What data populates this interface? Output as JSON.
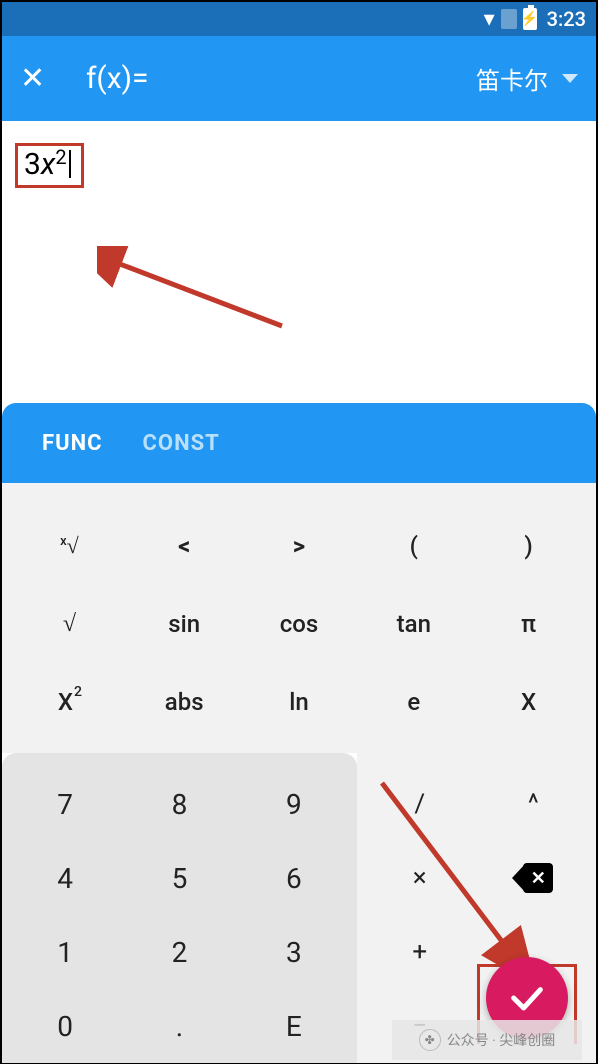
{
  "status": {
    "time": "3:23"
  },
  "header": {
    "close_glyph": "✕",
    "fx_label": "f(x)=",
    "dropdown_label": "笛卡尔"
  },
  "expression": {
    "coeff": "3",
    "var": "x",
    "exp": "2"
  },
  "tabs": {
    "func": "FUNC",
    "const": "CONST"
  },
  "keys_upper": {
    "r0": [
      "ⁿ√",
      "<",
      ">",
      "(",
      ")"
    ],
    "r1": [
      "√",
      "sin",
      "cos",
      "tan",
      "π"
    ],
    "r2": [
      "X²",
      "abs",
      "ln",
      "e",
      "X"
    ]
  },
  "numpad": {
    "r0": [
      "7",
      "8",
      "9"
    ],
    "r1": [
      "4",
      "5",
      "6"
    ],
    "r2": [
      "1",
      "2",
      "3"
    ],
    "r3": [
      "0",
      ".",
      "E"
    ]
  },
  "ops": {
    "r0": [
      "/",
      "^"
    ],
    "r1": [
      "×",
      "⌫"
    ],
    "r2": [
      "+",
      ""
    ],
    "r3": [
      "−",
      ""
    ]
  },
  "watermark": {
    "text": "公众号 · 尖峰创圈"
  }
}
